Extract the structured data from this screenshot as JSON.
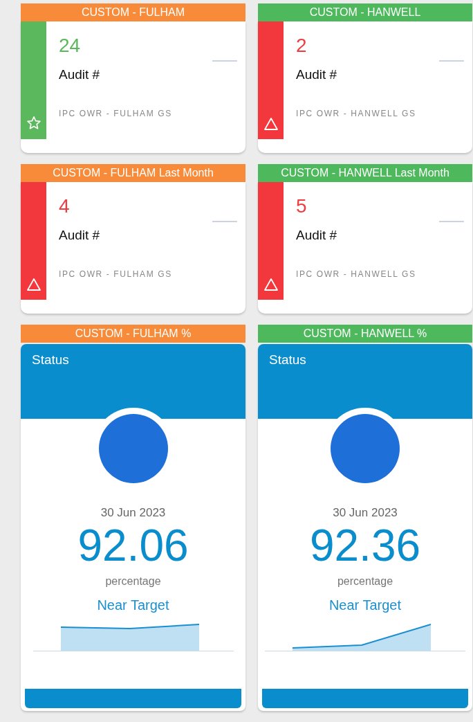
{
  "tiles": [
    {
      "title": "CUSTOM - FULHAM",
      "color": "#f78b3a",
      "kind": "good",
      "value": "24",
      "label": "Audit #",
      "source": "IPC OWR - FULHAM GS"
    },
    {
      "title": "CUSTOM - HANWELL",
      "color": "#4db85c",
      "kind": "alert",
      "value": "2",
      "label": "Audit #",
      "source": "IPC OWR - HANWELL GS"
    },
    {
      "title": "CUSTOM - FULHAM Last Month",
      "color": "#f78b3a",
      "kind": "alert",
      "value": "4",
      "label": "Audit #",
      "source": "IPC OWR - FULHAM GS"
    },
    {
      "title": "CUSTOM - HANWELL Last Month",
      "color": "#4db85c",
      "kind": "alert",
      "value": "5",
      "label": "Audit #",
      "source": "IPC OWR - HANWELL GS"
    }
  ],
  "status_cards": [
    {
      "title": "CUSTOM - FULHAM %",
      "color": "#f78b3a",
      "heading": "Status",
      "date": "30 Jun 2023",
      "value": "92.06",
      "unit": "percentage",
      "status": "Near Target"
    },
    {
      "title": "CUSTOM - HANWELL %",
      "color": "#4db85c",
      "heading": "Status",
      "date": "30 Jun 2023",
      "value": "92.36",
      "unit": "percentage",
      "status": "Near Target"
    }
  ]
}
